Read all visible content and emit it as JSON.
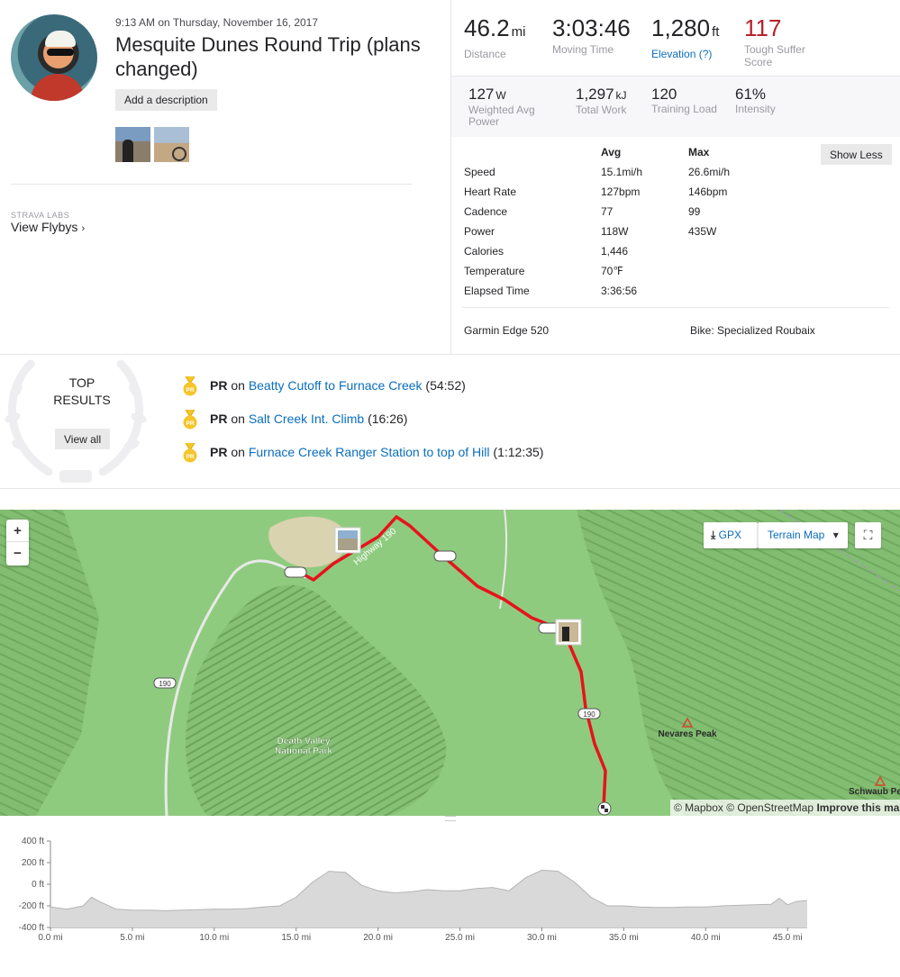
{
  "activity": {
    "date": "9:13 AM on Thursday, November 16, 2017",
    "title": "Mesquite Dunes Round Trip (plans changed)",
    "add_description": "Add a description",
    "labs_label": "STRAVA LABS",
    "flybys": "View Flybys",
    "chevron_icon": "›"
  },
  "primary_stats": [
    {
      "value": "46.2",
      "unit": "mi",
      "label": "Distance"
    },
    {
      "value": "3:03:46",
      "unit": "",
      "label": "Moving Time"
    },
    {
      "value": "1,280",
      "unit": "ft",
      "label": "Elevation (?)"
    },
    {
      "value": "117",
      "unit": "",
      "label": "Tough Suffer Score"
    }
  ],
  "secondary_stats": [
    {
      "value": "127",
      "unit": "W",
      "label": "Weighted Avg Power"
    },
    {
      "value": "1,297",
      "unit": "kJ",
      "label": "Total Work"
    },
    {
      "value": "120",
      "unit": "",
      "label": "Training Load"
    },
    {
      "value": "61%",
      "unit": "",
      "label": "Intensity"
    }
  ],
  "more_stats": {
    "header_avg": "Avg",
    "header_max": "Max",
    "show_less": "Show Less",
    "rows": [
      {
        "label": "Speed",
        "avg": "15.1mi/h",
        "max": "26.6mi/h"
      },
      {
        "label": "Heart Rate",
        "avg": "127bpm",
        "max": "146bpm"
      },
      {
        "label": "Cadence",
        "avg": "77",
        "max": "99"
      },
      {
        "label": "Power",
        "avg": "118W",
        "max": "435W"
      },
      {
        "label": "Calories",
        "avg": "1,446",
        "max": ""
      },
      {
        "label": "Temperature",
        "avg": "70℉",
        "max": ""
      },
      {
        "label": "Elapsed Time",
        "avg": "3:36:56",
        "max": ""
      }
    ],
    "device": "Garmin Edge 520",
    "bike": "Bike: Specialized Roubaix"
  },
  "top_results": {
    "title_line1": "TOP",
    "title_line2": "RESULTS",
    "view_all": "View all",
    "achievements": [
      {
        "badge": "PR",
        "on": " on ",
        "segment": "Beatty Cutoff to Furnace Creek",
        "time": " (54:52)"
      },
      {
        "badge": "PR",
        "on": " on ",
        "segment": "Salt Creek Int. Climb",
        "time": " (16:26)"
      },
      {
        "badge": "PR",
        "on": " on ",
        "segment": "Furnace Creek Ranger Station to top of Hill",
        "time": " (1:12:35)"
      }
    ]
  },
  "map": {
    "zoom_in": "+",
    "zoom_out": "−",
    "gpx": "GPX",
    "terrain": "Terrain Map",
    "dropdown_icon": "▾",
    "download_icon": "⤓",
    "fullscreen_icon": "⛶",
    "labels": {
      "highway": "Highway 190",
      "park_line1": "Death Valley",
      "park_line2": "National Park",
      "peak1": "Nevares Peak",
      "peak2": "Schwaub Pe",
      "route_num": "190"
    },
    "attribution_left": "© Mapbox © OpenStreetMap ",
    "attribution_bold": "Improve this map",
    "route_color": "#e8121c",
    "terrain_color": "#8fcb7f"
  },
  "chart_data": {
    "type": "area",
    "ylabels": [
      "400 ft",
      "200 ft",
      "0 ft",
      "-200 ft",
      "-400 ft"
    ],
    "xlabels": [
      "0.0 mi",
      "5.0 mi",
      "10.0 mi",
      "15.0 mi",
      "20.0 mi",
      "25.0 mi",
      "30.0 mi",
      "35.0 mi",
      "40.0 mi",
      "45.0 mi"
    ],
    "xlim": [
      0,
      46.2
    ],
    "ylim": [
      -400,
      400
    ],
    "x": [
      0,
      1,
      2,
      2.5,
      3,
      4,
      5,
      6,
      7,
      8,
      9,
      10,
      11,
      12,
      13,
      14,
      15,
      16,
      17,
      18,
      19,
      20,
      21,
      22,
      23,
      24,
      25,
      26,
      27,
      28,
      29,
      30,
      31,
      32,
      33,
      34,
      35,
      36,
      37,
      38,
      39,
      40,
      41,
      42,
      43,
      44,
      44.5,
      45,
      45.5,
      46.2
    ],
    "y": [
      -210,
      -230,
      -200,
      -120,
      -160,
      -230,
      -240,
      -240,
      -245,
      -240,
      -235,
      -230,
      -230,
      -225,
      -210,
      -200,
      -120,
      20,
      120,
      110,
      -10,
      -60,
      -80,
      -70,
      -50,
      -60,
      -60,
      -40,
      -30,
      -60,
      60,
      130,
      120,
      20,
      -120,
      -200,
      -200,
      -210,
      -215,
      -215,
      -210,
      -210,
      -200,
      -195,
      -190,
      -185,
      -130,
      -190,
      -160,
      -150
    ],
    "fill": "#d9d9d9",
    "stroke": "#b5b5b5"
  }
}
